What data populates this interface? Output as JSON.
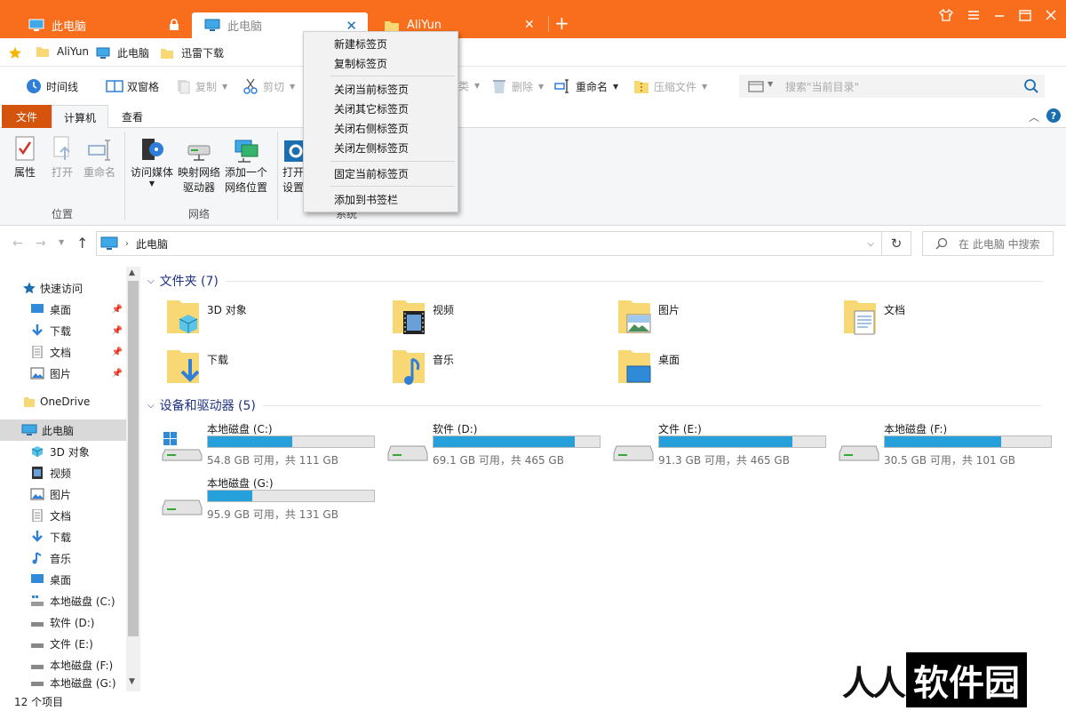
{
  "colors": {
    "accent": "#f86e1c",
    "bar_fill": "#26a0da",
    "section_header": "#1e3287"
  },
  "tabs": [
    {
      "label": "此电脑",
      "locked": true
    },
    {
      "label": "此电脑",
      "active": true
    },
    {
      "label": "AliYun"
    }
  ],
  "bookmarks": [
    "AliYun",
    "此电脑",
    "迅雷下载"
  ],
  "toolbar": {
    "timeline": "时间线",
    "dual_pane": "双窗格",
    "copy": "复制",
    "cut": "剪切",
    "partial_hidden": "类",
    "delete": "删除",
    "rename": "重命名",
    "compress": "压缩文件",
    "search_placeholder": "搜索\"当前目录\""
  },
  "ribbon": {
    "tabs": {
      "file": "文件",
      "computer": "计算机",
      "view": "查看"
    },
    "properties": "属性",
    "open": "打开",
    "rename": "重命名",
    "access_media": "访问媒体",
    "map_drive_1": "映射网络",
    "map_drive_2": "驱动器",
    "add_location_1": "添加一个",
    "add_location_2": "网络位置",
    "open_settings_1": "打开",
    "open_settings_2": "设置",
    "group_location": "位置",
    "group_network": "网络",
    "group_system": "系统"
  },
  "address": {
    "crumb": "此电脑",
    "search_placeholder": "在 此电脑 中搜索"
  },
  "nav": {
    "quick_access": "快速访问",
    "quick": [
      {
        "label": "桌面"
      },
      {
        "label": "下载"
      },
      {
        "label": "文档"
      },
      {
        "label": "图片"
      }
    ],
    "onedrive": "OneDrive",
    "this_pc": "此电脑",
    "pc_items": [
      {
        "label": "3D 对象"
      },
      {
        "label": "视频"
      },
      {
        "label": "图片"
      },
      {
        "label": "文档"
      },
      {
        "label": "下载"
      },
      {
        "label": "音乐"
      },
      {
        "label": "桌面"
      },
      {
        "label": "本地磁盘 (C:)"
      },
      {
        "label": "软件 (D:)"
      },
      {
        "label": "文件 (E:)"
      },
      {
        "label": "本地磁盘 (F:)"
      },
      {
        "label": "本地磁盘 (G:)"
      }
    ]
  },
  "folders_header": "文件夹 (7)",
  "folders": [
    {
      "label": "3D 对象",
      "icon": "3d-objects-folder-icon"
    },
    {
      "label": "视频",
      "icon": "videos-folder-icon"
    },
    {
      "label": "图片",
      "icon": "pictures-folder-icon"
    },
    {
      "label": "文档",
      "icon": "documents-folder-icon"
    },
    {
      "label": "下载",
      "icon": "downloads-folder-icon"
    },
    {
      "label": "音乐",
      "icon": "music-folder-icon"
    },
    {
      "label": "桌面",
      "icon": "desktop-folder-icon"
    }
  ],
  "drives_header": "设备和驱动器 (5)",
  "drives": [
    {
      "name": "本地磁盘 (C:)",
      "info": "54.8 GB 可用，共 111 GB",
      "used_fraction": 0.51,
      "system": true
    },
    {
      "name": "软件 (D:)",
      "info": "69.1 GB 可用，共 465 GB",
      "used_fraction": 0.85
    },
    {
      "name": "文件 (E:)",
      "info": "91.3 GB 可用，共 465 GB",
      "used_fraction": 0.8
    },
    {
      "name": "本地磁盘 (F:)",
      "info": "30.5 GB 可用，共 101 GB",
      "used_fraction": 0.7
    },
    {
      "name": "本地磁盘 (G:)",
      "info": "95.9 GB 可用，共 131 GB",
      "used_fraction": 0.27
    }
  ],
  "status": "12 个项目",
  "context_menu": [
    "新建标签页",
    "复制标签页",
    "关闭当前标签页",
    "关闭其它标签页",
    "关闭右侧标签页",
    "关闭左侧标签页",
    "固定当前标签页",
    "添加到书签栏"
  ],
  "watermark": {
    "part1": "人人",
    "part2": "软件园"
  }
}
